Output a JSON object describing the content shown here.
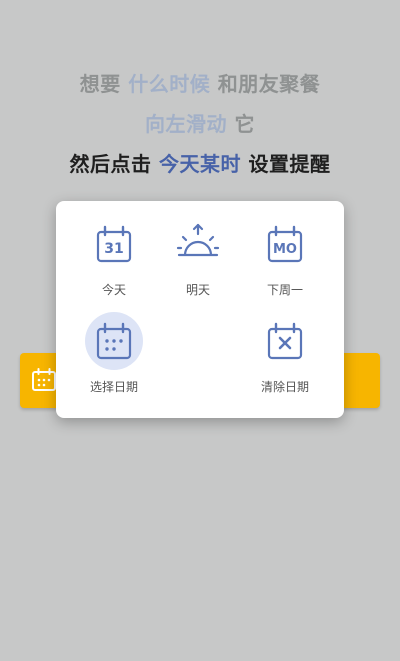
{
  "instructions": {
    "line1": {
      "prefix": "想要 ",
      "highlight": "什么时候",
      "suffix": " 和朋友聚餐"
    },
    "line2": {
      "highlight": "向左滑动",
      "suffix": " 它"
    },
    "line3": {
      "prefix": "然后点击 ",
      "highlight": "今天某时",
      "suffix": " 设置提醒"
    }
  },
  "task_bar": {
    "color": "#f7b500",
    "icon": "calendar-icon"
  },
  "date_picker": {
    "accent": "#5a76b8",
    "options": [
      {
        "key": "today",
        "label": "今天",
        "icon": "calendar-today-icon",
        "day_number": "31"
      },
      {
        "key": "tomorrow",
        "label": "明天",
        "icon": "sunrise-icon"
      },
      {
        "key": "next_monday",
        "label": "下周一",
        "icon": "calendar-monday-icon",
        "day_abbrev": "MO"
      },
      {
        "key": "pick_date",
        "label": "选择日期",
        "icon": "calendar-grid-icon",
        "selected": true
      },
      {
        "key": "clear_date",
        "label": "清除日期",
        "icon": "calendar-clear-icon"
      }
    ]
  }
}
